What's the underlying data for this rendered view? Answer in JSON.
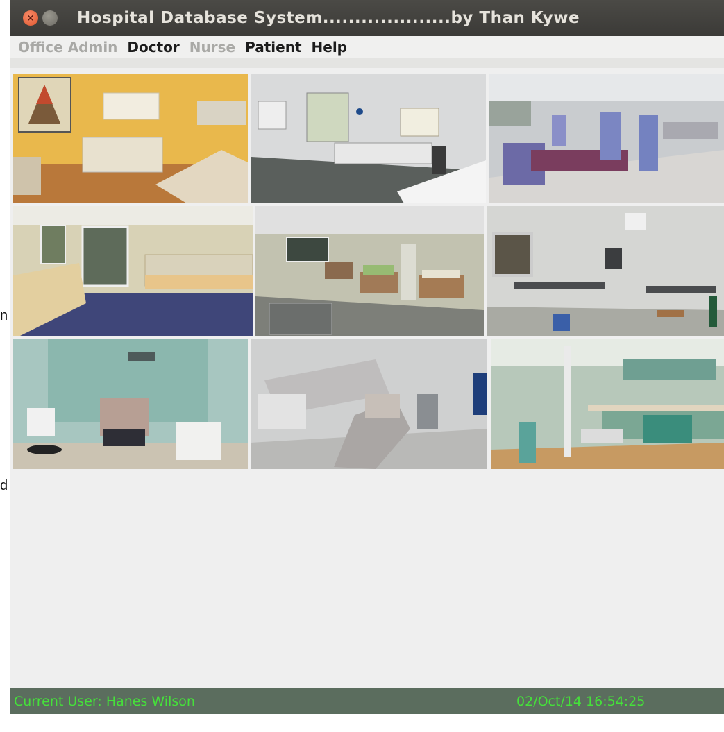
{
  "stray": {
    "char1": "n",
    "char2": "d"
  },
  "window": {
    "title": "Hospital Database System....................by Than Kywe",
    "close_glyph": "×",
    "min_glyph": "–"
  },
  "menu": [
    {
      "label": "Office Admin",
      "enabled": false
    },
    {
      "label": "Doctor",
      "enabled": true
    },
    {
      "label": "Nurse",
      "enabled": false
    },
    {
      "label": "Patient",
      "enabled": true
    },
    {
      "label": "Help",
      "enabled": true
    }
  ],
  "gallery": {
    "photos": [
      {
        "subject": "exam-room-yellow"
      },
      {
        "subject": "office-room"
      },
      {
        "subject": "dental-lab"
      },
      {
        "subject": "reception-area"
      },
      {
        "subject": "patient-ward"
      },
      {
        "subject": "veterinary-surgery"
      },
      {
        "subject": "dental-chair-green"
      },
      {
        "subject": "dental-chair-grey"
      },
      {
        "subject": "dental-clinic-teal"
      }
    ]
  },
  "status": {
    "user": "Current User: Hanes Wilson",
    "datetime": "02/Oct/14 16:54:25",
    "text_color": "#45e13a"
  }
}
